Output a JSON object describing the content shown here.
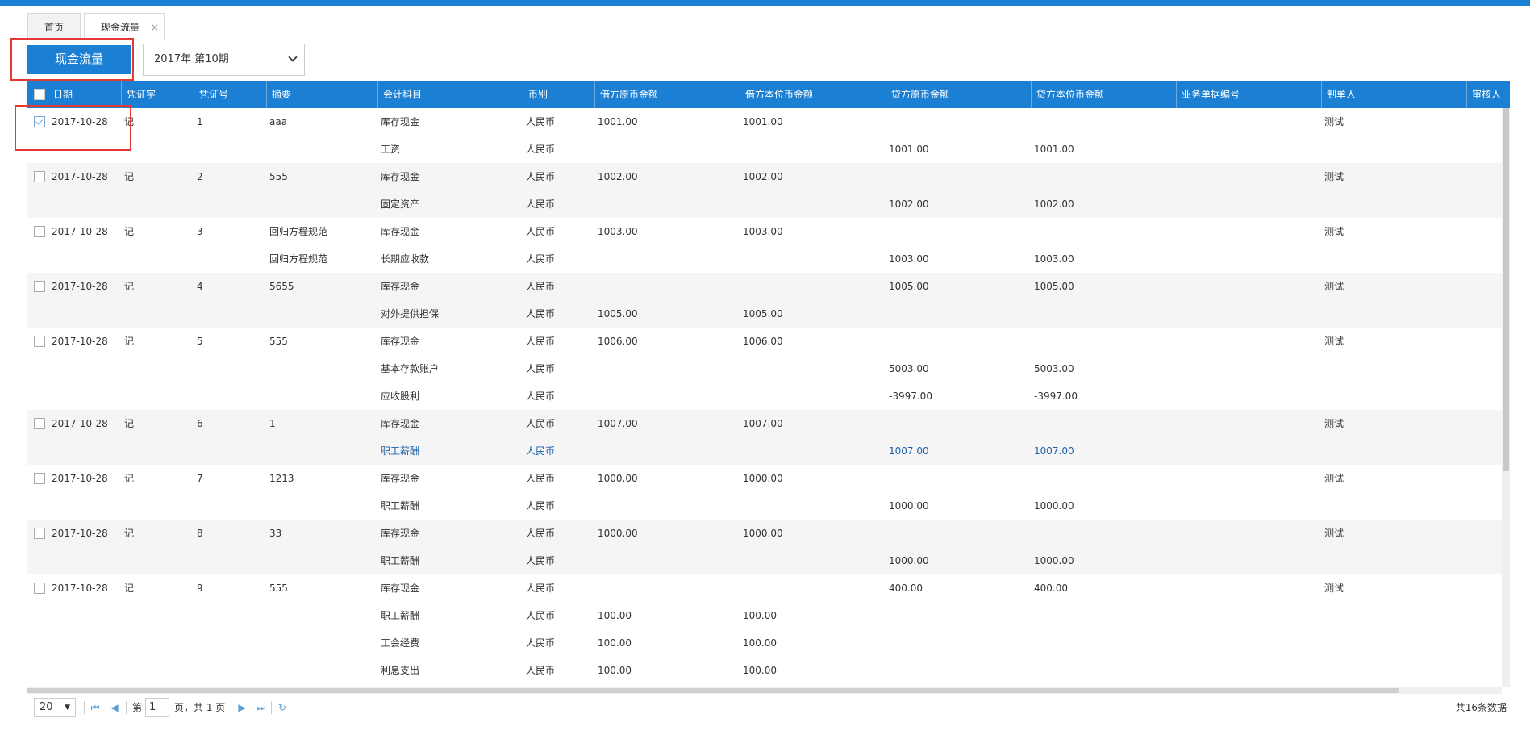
{
  "tabs": [
    {
      "label": "首页"
    },
    {
      "label": "现金流量",
      "close": "×"
    }
  ],
  "toolbar": {
    "cashflow_button": "现金流量",
    "period": "2017年 第10期"
  },
  "grid": {
    "columns": [
      "日期",
      "凭证字",
      "凭证号",
      "摘要",
      "会计科目",
      "币别",
      "借方原币金额",
      "借方本位币金额",
      "贷方原币金额",
      "贷方本位币金额",
      "业务单据编号",
      "制单人",
      "审核人"
    ],
    "groups": [
      {
        "checked": true,
        "date": "2017-10-28",
        "word": "记",
        "no": "1",
        "maker": "测试",
        "lines": [
          {
            "summary": "aaa",
            "account": "库存现金",
            "currency": "人民币",
            "debit_orig": "1001.00",
            "debit_base": "1001.00",
            "credit_orig": "",
            "credit_base": ""
          },
          {
            "summary": "",
            "account": "工资",
            "currency": "人民币",
            "debit_orig": "",
            "debit_base": "",
            "credit_orig": "1001.00",
            "credit_base": "1001.00"
          }
        ]
      },
      {
        "checked": false,
        "date": "2017-10-28",
        "word": "记",
        "no": "2",
        "maker": "测试",
        "lines": [
          {
            "summary": "555",
            "account": "库存现金",
            "currency": "人民币",
            "debit_orig": "1002.00",
            "debit_base": "1002.00",
            "credit_orig": "",
            "credit_base": ""
          },
          {
            "summary": "",
            "account": "固定资产",
            "currency": "人民币",
            "debit_orig": "",
            "debit_base": "",
            "credit_orig": "1002.00",
            "credit_base": "1002.00"
          }
        ]
      },
      {
        "checked": false,
        "date": "2017-10-28",
        "word": "记",
        "no": "3",
        "maker": "测试",
        "lines": [
          {
            "summary": "回归方程规范",
            "account": "库存现金",
            "currency": "人民币",
            "debit_orig": "1003.00",
            "debit_base": "1003.00",
            "credit_orig": "",
            "credit_base": ""
          },
          {
            "summary": "回归方程规范",
            "account": "长期应收款",
            "currency": "人民币",
            "debit_orig": "",
            "debit_base": "",
            "credit_orig": "1003.00",
            "credit_base": "1003.00"
          }
        ]
      },
      {
        "checked": false,
        "date": "2017-10-28",
        "word": "记",
        "no": "4",
        "maker": "测试",
        "lines": [
          {
            "summary": "5655",
            "account": "库存现金",
            "currency": "人民币",
            "debit_orig": "",
            "debit_base": "",
            "credit_orig": "1005.00",
            "credit_base": "1005.00"
          },
          {
            "summary": "",
            "account": "对外提供担保",
            "currency": "人民币",
            "debit_orig": "1005.00",
            "debit_base": "1005.00",
            "credit_orig": "",
            "credit_base": ""
          }
        ]
      },
      {
        "checked": false,
        "date": "2017-10-28",
        "word": "记",
        "no": "5",
        "maker": "测试",
        "lines": [
          {
            "summary": "555",
            "account": "库存现金",
            "currency": "人民币",
            "debit_orig": "1006.00",
            "debit_base": "1006.00",
            "credit_orig": "",
            "credit_base": ""
          },
          {
            "summary": "",
            "account": "基本存款账户",
            "currency": "人民币",
            "debit_orig": "",
            "debit_base": "",
            "credit_orig": "5003.00",
            "credit_base": "5003.00"
          },
          {
            "summary": "",
            "account": "应收股利",
            "currency": "人民币",
            "debit_orig": "",
            "debit_base": "",
            "credit_orig": "-3997.00",
            "credit_base": "-3997.00"
          }
        ]
      },
      {
        "checked": false,
        "date": "2017-10-28",
        "word": "记",
        "no": "6",
        "maker": "测试",
        "lines": [
          {
            "summary": "1",
            "account": "库存现金",
            "currency": "人民币",
            "debit_orig": "1007.00",
            "debit_base": "1007.00",
            "credit_orig": "",
            "credit_base": ""
          },
          {
            "summary": "",
            "account": "职工薪酬",
            "currency": "人民币",
            "debit_orig": "",
            "debit_base": "",
            "credit_orig": "1007.00",
            "credit_base": "1007.00",
            "highlight": true
          }
        ]
      },
      {
        "checked": false,
        "date": "2017-10-28",
        "word": "记",
        "no": "7",
        "maker": "测试",
        "lines": [
          {
            "summary": "1213",
            "account": "库存现金",
            "currency": "人民币",
            "debit_orig": "1000.00",
            "debit_base": "1000.00",
            "credit_orig": "",
            "credit_base": ""
          },
          {
            "summary": "",
            "account": "职工薪酬",
            "currency": "人民币",
            "debit_orig": "",
            "debit_base": "",
            "credit_orig": "1000.00",
            "credit_base": "1000.00"
          }
        ]
      },
      {
        "checked": false,
        "date": "2017-10-28",
        "word": "记",
        "no": "8",
        "maker": "测试",
        "lines": [
          {
            "summary": "33",
            "account": "库存现金",
            "currency": "人民币",
            "debit_orig": "1000.00",
            "debit_base": "1000.00",
            "credit_orig": "",
            "credit_base": ""
          },
          {
            "summary": "",
            "account": "职工薪酬",
            "currency": "人民币",
            "debit_orig": "",
            "debit_base": "",
            "credit_orig": "1000.00",
            "credit_base": "1000.00"
          }
        ]
      },
      {
        "checked": false,
        "date": "2017-10-28",
        "word": "记",
        "no": "9",
        "maker": "测试",
        "lines": [
          {
            "summary": "555",
            "account": "库存现金",
            "currency": "人民币",
            "debit_orig": "",
            "debit_base": "",
            "credit_orig": "400.00",
            "credit_base": "400.00"
          },
          {
            "summary": "",
            "account": "职工薪酬",
            "currency": "人民币",
            "debit_orig": "100.00",
            "debit_base": "100.00",
            "credit_orig": "",
            "credit_base": ""
          },
          {
            "summary": "",
            "account": "工会经费",
            "currency": "人民币",
            "debit_orig": "100.00",
            "debit_base": "100.00",
            "credit_orig": "",
            "credit_base": ""
          },
          {
            "summary": "",
            "account": "利息支出",
            "currency": "人民币",
            "debit_orig": "100.00",
            "debit_base": "100.00",
            "credit_orig": "",
            "credit_base": ""
          }
        ]
      }
    ]
  },
  "pager": {
    "page_size": "20",
    "page_prefix": "第",
    "page_value": "1",
    "page_suffix": "页，共 1 页",
    "total": "共16条数据",
    "icons": {
      "first": "first-page-icon",
      "prev": "prev-page-icon",
      "next": "next-page-icon",
      "last": "last-page-icon",
      "refresh": "refresh-icon"
    }
  }
}
